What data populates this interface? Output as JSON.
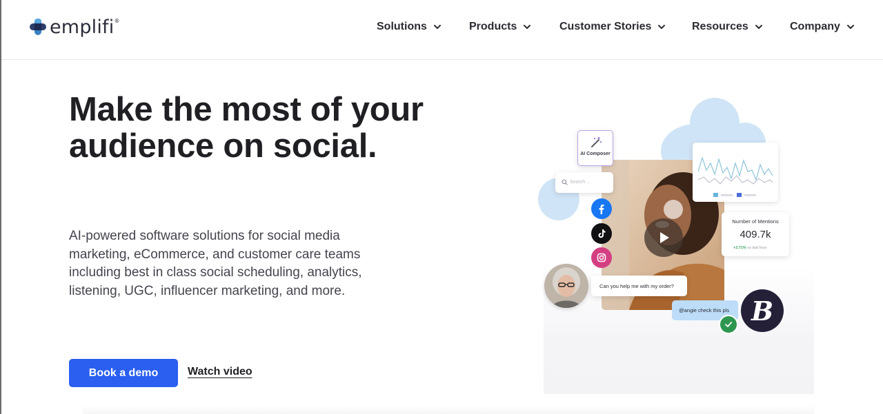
{
  "brand": {
    "name": "emplifi",
    "tm": "®",
    "colors": {
      "accent": "#2a5ff0",
      "text": "#1f1f24",
      "cloud": "#cfe4f6"
    }
  },
  "nav": {
    "items": [
      {
        "label": "Solutions",
        "icon": "chevron-down-icon"
      },
      {
        "label": "Products",
        "icon": "chevron-down-icon"
      },
      {
        "label": "Customer Stories",
        "icon": "chevron-down-icon"
      },
      {
        "label": "Resources",
        "icon": "chevron-down-icon"
      },
      {
        "label": "Company",
        "icon": "chevron-down-icon"
      }
    ]
  },
  "hero": {
    "headline": "Make the most of your audience on social.",
    "subtext": "AI-powered software solutions for social media marketing, eCommerce, and customer care teams including best in class social scheduling, analytics, listening, UGC, influencer marketing, and more.",
    "cta_primary": "Book a demo",
    "cta_secondary": "Watch video"
  },
  "illustration": {
    "ai_composer_label": "AI Composer",
    "search_placeholder": "Search ...",
    "mentions": {
      "label": "Number of Mentions",
      "value": "409.7k",
      "change": "+2.71%",
      "change_suffix": "vs last hour"
    },
    "chat_customer": "Can you help me with my order?",
    "chat_agent": "@angie check this pls",
    "brand_badge": "B",
    "social_icons": [
      "facebook-icon",
      "tiktok-icon",
      "instagram-icon"
    ]
  }
}
